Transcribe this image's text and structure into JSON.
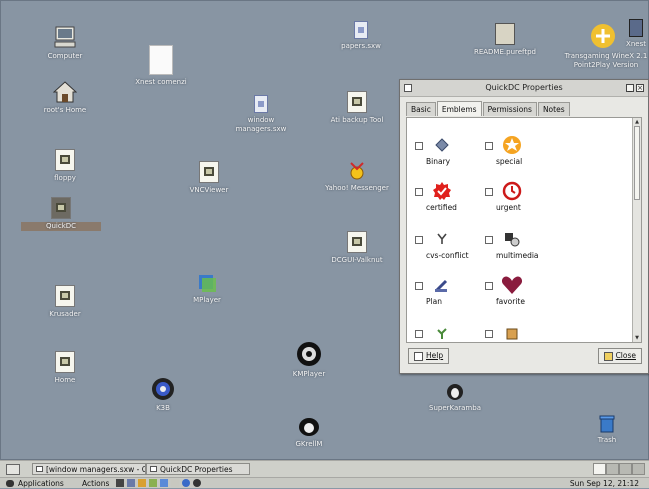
{
  "desktop": {
    "icons": [
      {
        "label": "Computer"
      },
      {
        "label": "Xnest comenzi"
      },
      {
        "label": "papers.sxw"
      },
      {
        "label": "README.pureftpd"
      },
      {
        "label": "Transgaming WineX 2.1 Point2Play Version"
      },
      {
        "label": "Xnest"
      },
      {
        "label": "root's Home"
      },
      {
        "label": "window managers.sxw"
      },
      {
        "label": "Ati backup Tool"
      },
      {
        "label": "floppy"
      },
      {
        "label": "VNCViewer"
      },
      {
        "label": "Yahoo! Messenger"
      },
      {
        "label": "QuickDC"
      },
      {
        "label": "DCGUI-Valknut"
      },
      {
        "label": "Krusader"
      },
      {
        "label": "MPlayer"
      },
      {
        "label": "KMPlayer"
      },
      {
        "label": "Home"
      },
      {
        "label": "K3B"
      },
      {
        "label": "SuperKaramba"
      },
      {
        "label": "GKrellM"
      },
      {
        "label": "Trash"
      }
    ]
  },
  "window": {
    "title": "QuickDC Properties",
    "tabs": [
      {
        "label": "Basic"
      },
      {
        "label": "Emblems"
      },
      {
        "label": "Permissions"
      },
      {
        "label": "Notes"
      }
    ],
    "emblems": [
      {
        "label": "Binary",
        "icon": "diamond-icon"
      },
      {
        "label": "special",
        "icon": "star-icon"
      },
      {
        "label": "certified",
        "icon": "seal-icon"
      },
      {
        "label": "urgent",
        "icon": "clock-icon"
      },
      {
        "label": "cvs-conflict",
        "icon": "cvs-icon"
      },
      {
        "label": "multimedia",
        "icon": "film-icon"
      },
      {
        "label": "Plan",
        "icon": "pencil-icon"
      },
      {
        "label": "favorite",
        "icon": "heart-icon"
      }
    ],
    "help_label": "Help",
    "close_label": "Close"
  },
  "taskbar": {
    "tasks": [
      {
        "label": "[window managers.sxw - O"
      },
      {
        "label": "QuickDC Properties"
      }
    ]
  },
  "menubar": {
    "applications_label": "Applications",
    "actions_label": "Actions",
    "clock": "Sun Sep 12, 21:12"
  },
  "colors": {
    "desktop": "#8895a3",
    "special_star": "#f5a422",
    "certified_seal": "#e0201c",
    "urgent_clock": "#cc1a1a",
    "favorite_heart": "#8a1c3e"
  }
}
